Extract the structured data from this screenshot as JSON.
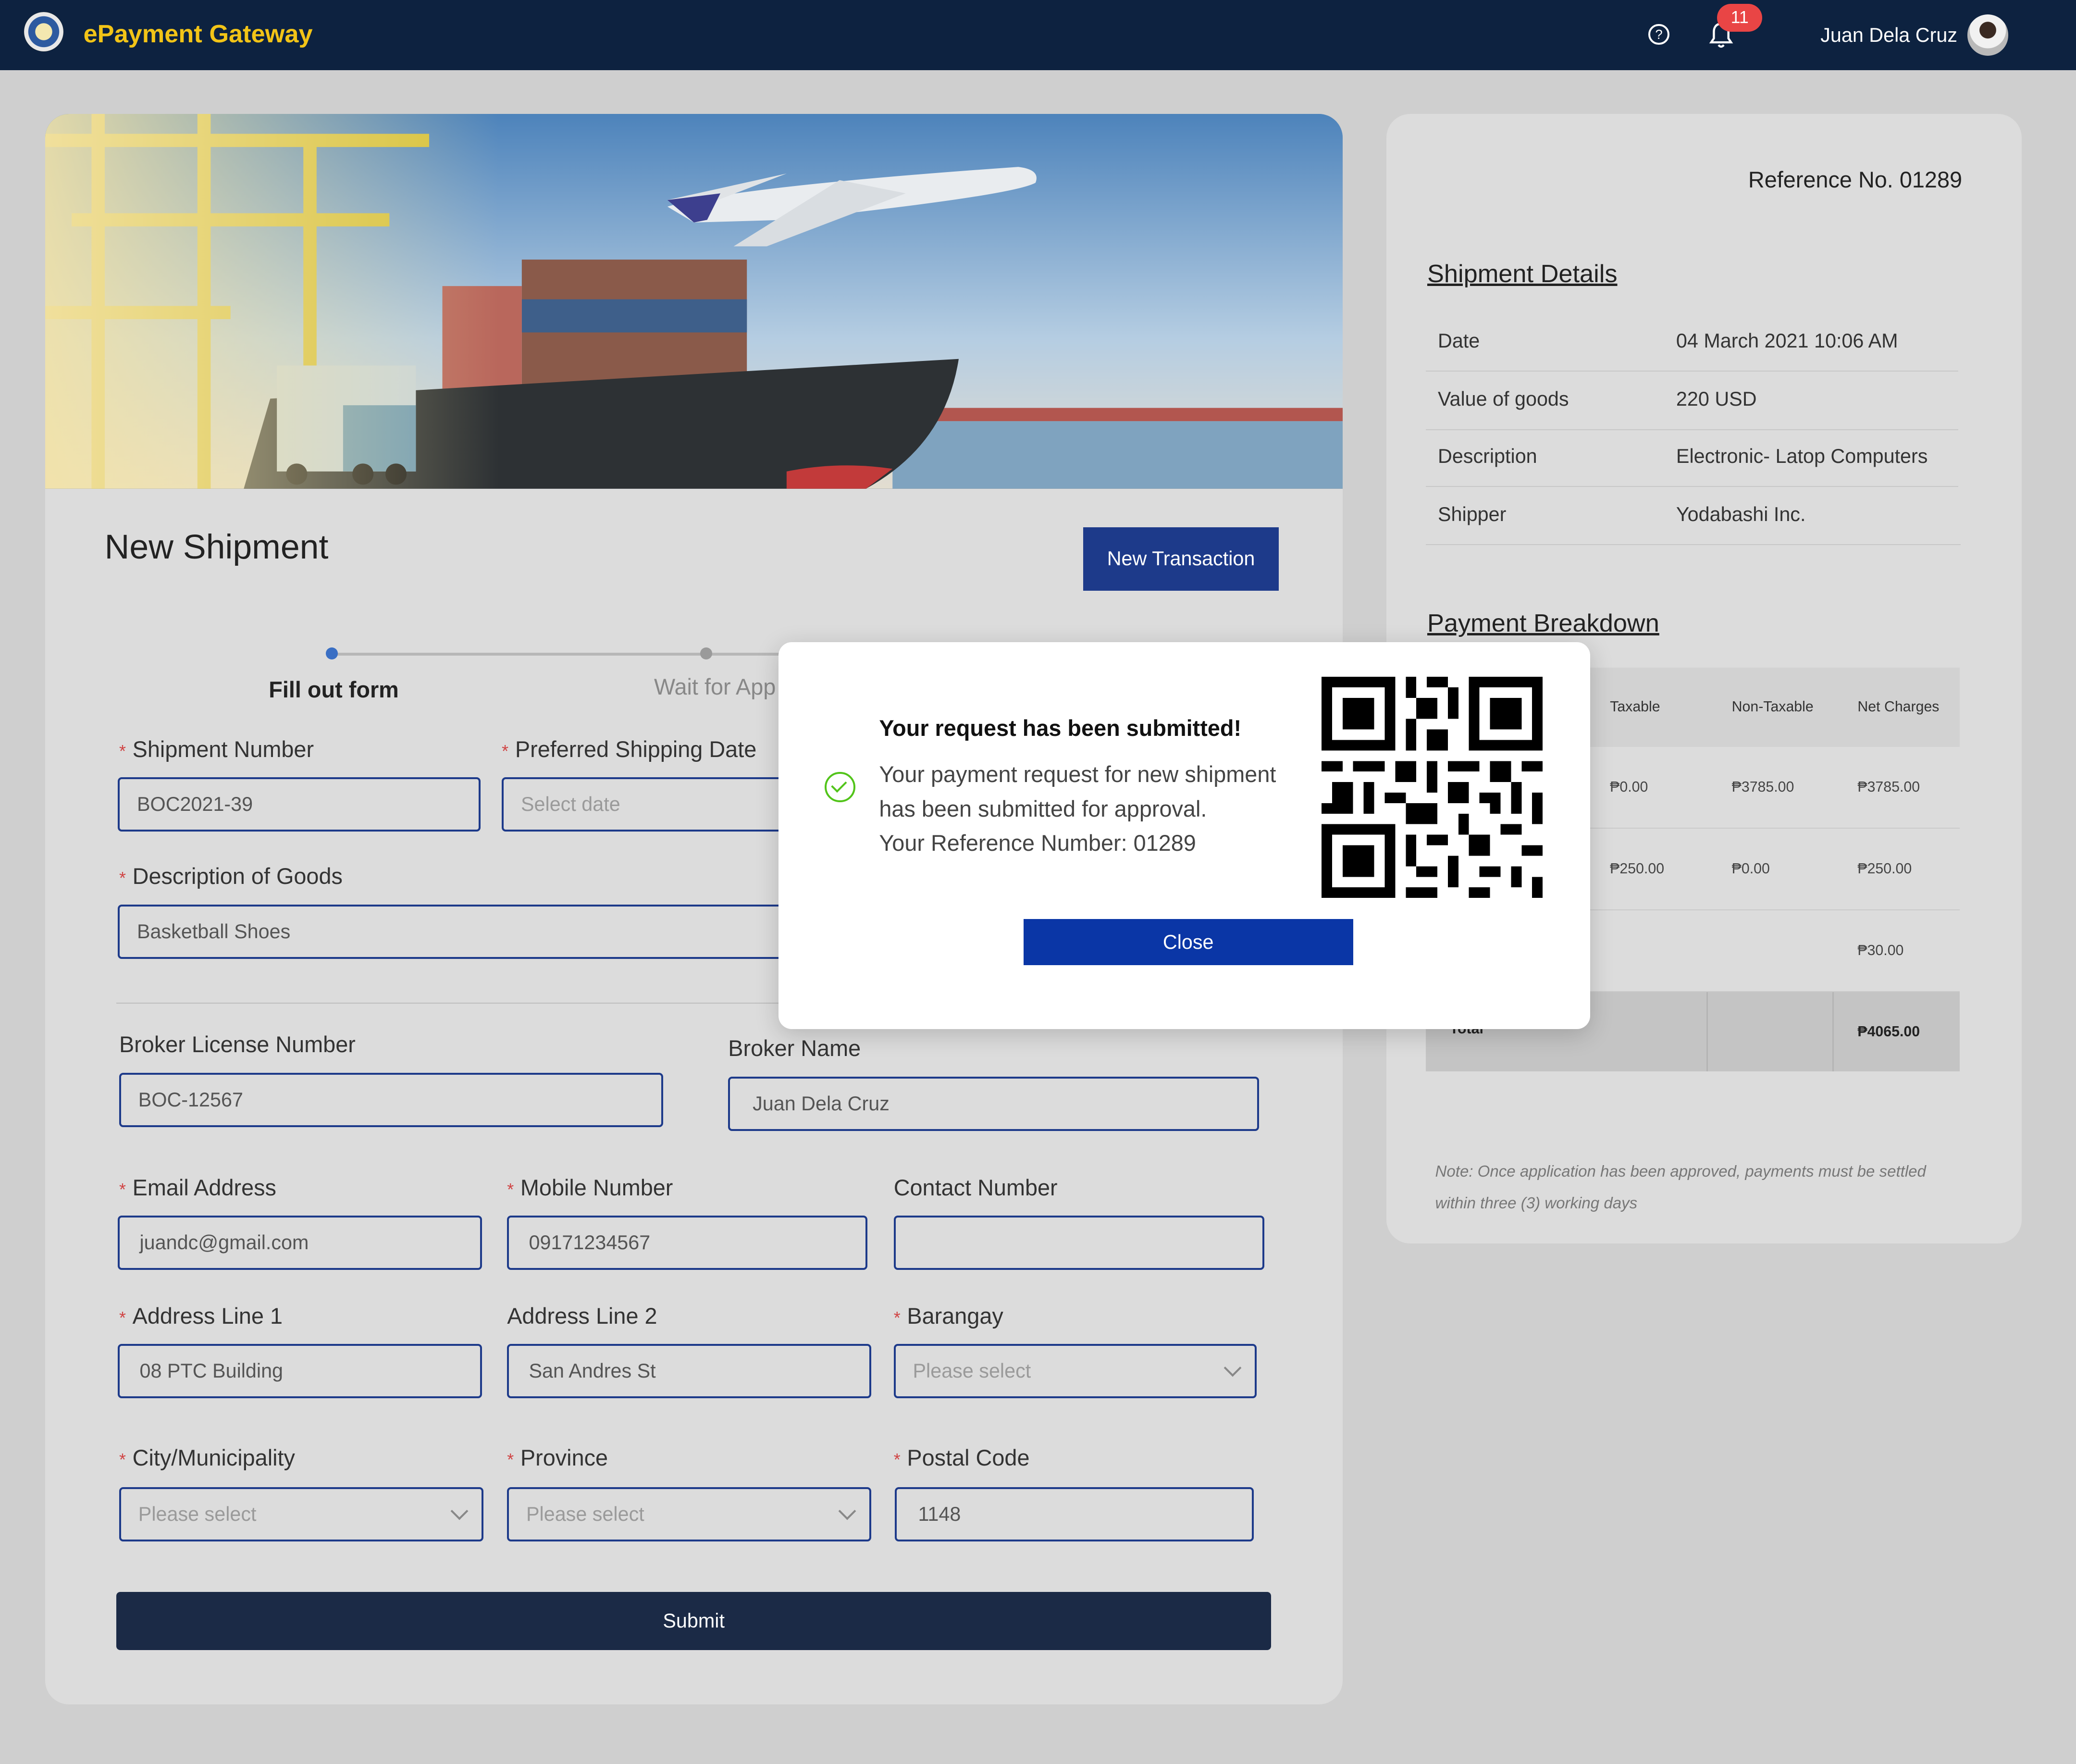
{
  "header": {
    "brand": "ePayment Gateway",
    "notification_count": "11",
    "user_name": "Juan Dela Cruz",
    "help_glyph": "?"
  },
  "form": {
    "title": "New Shipment",
    "new_transaction_label": "New Transaction",
    "steps": [
      {
        "label": "Fill out form",
        "active": true
      },
      {
        "label": "Wait for App",
        "active": false
      }
    ],
    "shipment_number": {
      "label": "Shipment Number",
      "value": "BOC2021-39"
    },
    "preferred_date": {
      "label": "Preferred Shipping Date",
      "placeholder": "Select date"
    },
    "description": {
      "label": "Description of Goods",
      "value": "Basketball Shoes"
    },
    "broker_license": {
      "label": "Broker License Number",
      "value": "BOC-12567"
    },
    "broker_name": {
      "label": "Broker Name",
      "value": "Juan Dela Cruz"
    },
    "email": {
      "label": "Email Address",
      "value": "juandc@gmail.com"
    },
    "mobile": {
      "label": "Mobile Number",
      "value": "09171234567"
    },
    "contact": {
      "label": "Contact Number",
      "value": ""
    },
    "address1": {
      "label": "Address Line 1",
      "value": "08 PTC Building"
    },
    "address2": {
      "label": "Address Line 2",
      "value": "San Andres St"
    },
    "barangay": {
      "label": "Barangay",
      "placeholder": "Please select"
    },
    "city": {
      "label": "City/Municipality",
      "placeholder": "Please select"
    },
    "province": {
      "label": "Province",
      "placeholder": "Please select"
    },
    "postal": {
      "label": "Postal Code",
      "value": "1148"
    },
    "submit_label": "Submit",
    "required_mark": "*"
  },
  "side": {
    "reference": "Reference No. 01289",
    "shipment_title": "Shipment Details",
    "details": [
      {
        "key": "Date",
        "value": "04 March 2021 10:06 AM"
      },
      {
        "key": "Value of goods",
        "value": "220 USD"
      },
      {
        "key": "Description",
        "value": "Electronic- Latop Computers"
      },
      {
        "key": "Shipper",
        "value": "Yodabashi Inc."
      }
    ],
    "payment_title": "Payment Breakdown",
    "payment": {
      "headers": [
        "Taxable",
        "Non-Taxable",
        "Net Charges"
      ],
      "rows": [
        [
          "₱0.00",
          "₱3785.00",
          "₱3785.00"
        ],
        [
          "₱250.00",
          "₱0.00",
          "₱250.00"
        ],
        [
          "",
          "",
          "₱30.00"
        ]
      ],
      "total_label": "Total",
      "total": "₱4065.00"
    },
    "note": "Note: Once application has been approved,  payments must be settled within three (3) working days"
  },
  "modal": {
    "title": "Your request has been submitted!",
    "line1": "Your payment request for new shipment",
    "line2": "has been submitted for approval.",
    "line3": "Your Reference Number: 01289",
    "close_label": "Close"
  },
  "colors": {
    "navy": "#0d2240",
    "brand_yellow": "#f2c417",
    "primary": "#1d3a8a",
    "success": "#52c41a",
    "badge": "#e94545"
  }
}
